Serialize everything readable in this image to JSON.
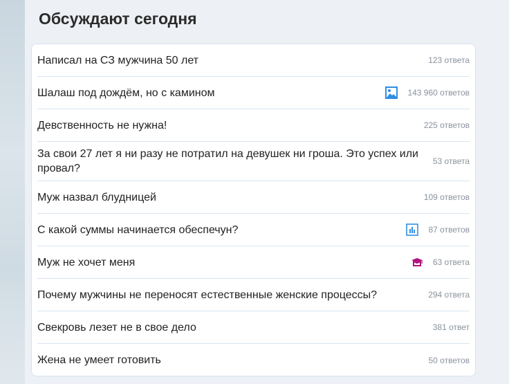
{
  "title": "Обсуждают сегодня",
  "items": [
    {
      "q": "Написал на СЗ мужчина 50 лет",
      "c": "123 ответа"
    },
    {
      "q": "Шалаш под дождём, но с камином",
      "c": "143 960 ответов",
      "icon": "image-icon"
    },
    {
      "q": "Девственность не нужна!",
      "c": "225 ответов"
    },
    {
      "q": "За свои 27 лет я ни разу не потратил на девушек ни гроша. Это успех или провал?",
      "c": "53 ответа"
    },
    {
      "q": "Муж назвал блудницей",
      "c": "109 ответов"
    },
    {
      "q": "С какой суммы начинается обеспечун?",
      "c": "87 ответов",
      "icon": "poll-icon"
    },
    {
      "q": "Муж не хочет меня",
      "c": "63 ответа",
      "icon": "graduation-cap-icon"
    },
    {
      "q": "Почему мужчины не переносят естественные женские процессы?",
      "c": "294 ответа"
    },
    {
      "q": "Свекровь лезет не в свое дело",
      "c": "381 ответ"
    },
    {
      "q": "Жена не умеет готовить",
      "c": "50 ответов"
    }
  ],
  "colors": {
    "icon_blue": "#2f8de4",
    "icon_magenta": "#b0127d"
  }
}
